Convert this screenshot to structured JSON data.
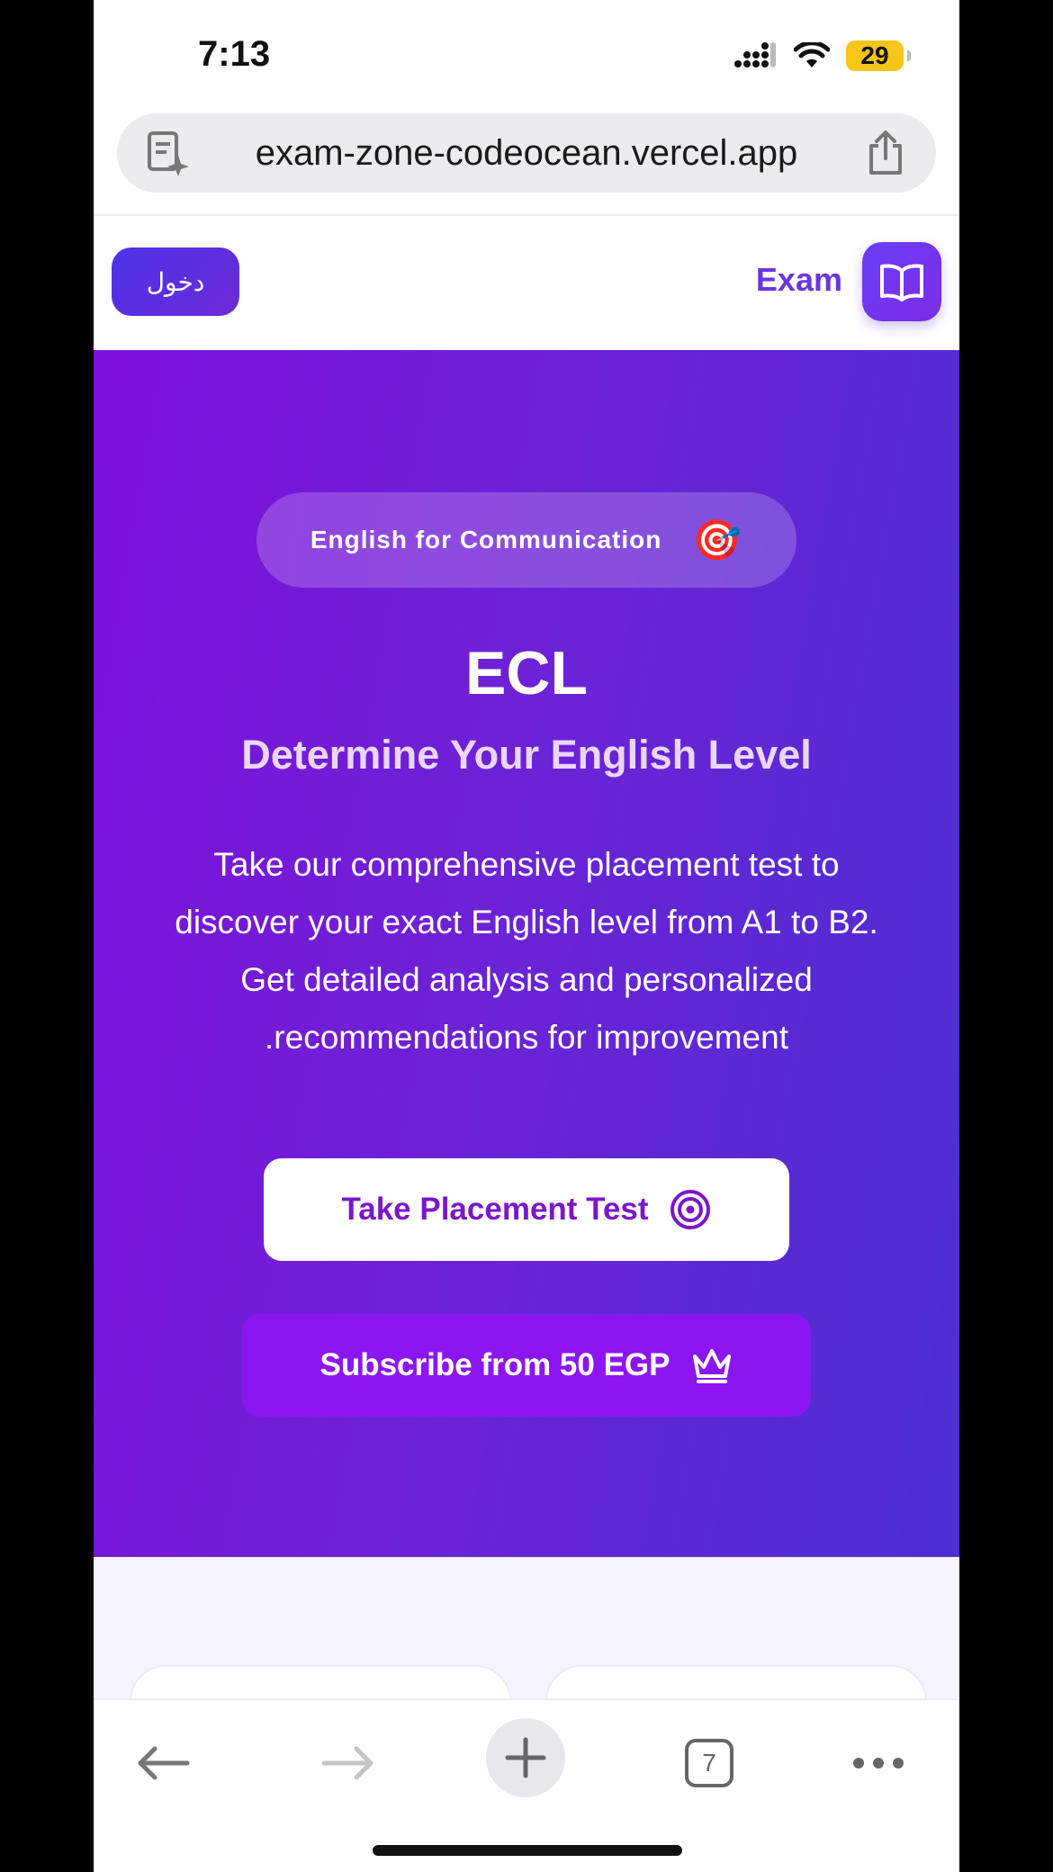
{
  "status_bar": {
    "time": "7:13",
    "battery": "29"
  },
  "browser": {
    "url": "exam-zone-codeocean.vercel.app",
    "tab_count": "7"
  },
  "header": {
    "login_label": "دخول",
    "brand": "Exam"
  },
  "hero": {
    "badge": "English for Communication",
    "badge_emoji": "🎯",
    "title": "ECL",
    "subtitle": "Determine Your English Level",
    "description_lines": [
      "Take our comprehensive placement test to",
      "discover your exact English level from A1 to B2.",
      "Get detailed analysis and personalized",
      ".recommendations for improvement"
    ],
    "primary_button": "Take Placement Test",
    "secondary_button": "Subscribe from 50 EGP"
  },
  "colors": {
    "brand": "#6a36e0",
    "hero_start": "#7e10db",
    "hero_end": "#4b2fd3",
    "subscribe": "#8c16f2",
    "battery": "#f5c518"
  },
  "icons": {
    "url": "page-sparkle-icon",
    "share": "share-icon",
    "brand": "open-book-icon",
    "primary": "target-icon",
    "secondary": "crown-icon"
  }
}
